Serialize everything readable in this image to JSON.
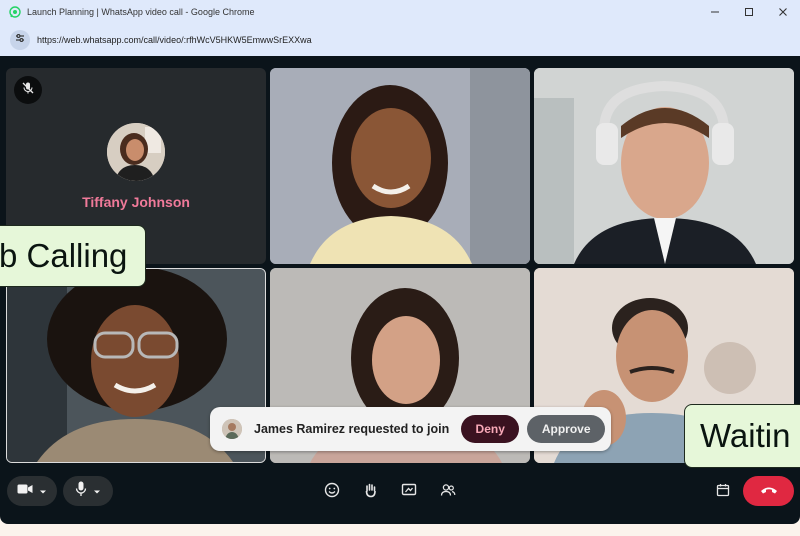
{
  "browser": {
    "title": "Launch Planning | WhatsApp video call - Google Chrome",
    "url": "https://web.whatsapp.com/call/video/:rfhWcV5HKW5EmwwSrEXXwa",
    "controls": [
      "minimize",
      "maximize",
      "close"
    ]
  },
  "call": {
    "participant_off_camera": "Tiffany Johnson",
    "tiles": [
      {
        "id": "tiffany-johnson",
        "video": false,
        "muted": true
      },
      {
        "id": "participant-2",
        "video": true
      },
      {
        "id": "participant-3",
        "video": true
      },
      {
        "id": "participant-4",
        "video": true
      },
      {
        "id": "participant-5",
        "video": true
      },
      {
        "id": "participant-6",
        "video": true
      }
    ]
  },
  "overlays": {
    "left_caption": "b Calling",
    "right_caption": "Waitin"
  },
  "join_request": {
    "text": "James Ramirez requested to join",
    "deny_label": "Deny",
    "approve_label": "Approve"
  },
  "toolbar": {
    "icons": [
      "camera-icon",
      "microphone-icon",
      "emoji-icon",
      "raise-hand-icon",
      "share-screen-icon",
      "participants-icon",
      "calendar-icon",
      "end-call-icon"
    ],
    "end_call_color": "#e02841"
  },
  "colors": {
    "name_accent": "#f07a9a",
    "caption_bg": "#e6f7d9",
    "deny_bg": "#3a1220"
  }
}
